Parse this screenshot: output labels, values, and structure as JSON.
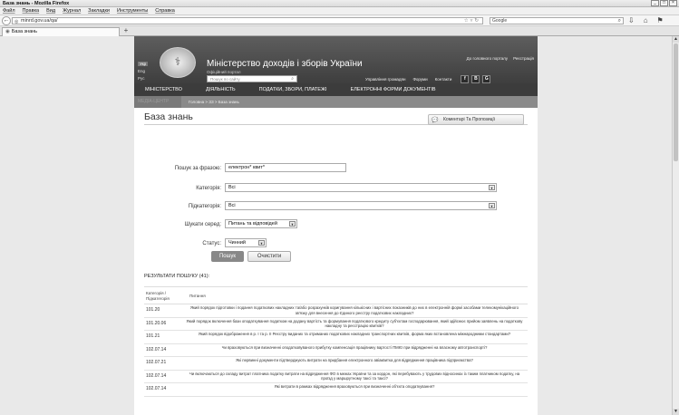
{
  "browser": {
    "window_title": "База знань - Mozilla Firefox",
    "window_controls": [
      "_",
      "□",
      "×"
    ],
    "menu": [
      "Файл",
      "Правка",
      "Вид",
      "Журнал",
      "Закладки",
      "Инструменты",
      "Справка"
    ],
    "url": "minrd.gov.ua/qa/",
    "search_engine": "Google",
    "tab_title": "База знань",
    "new_tab": "+"
  },
  "site": {
    "languages": [
      "Укр",
      "Eng",
      "Рус"
    ],
    "title": "Міністерство доходів і зборів України",
    "subtitle": "Офіційний портал",
    "search_placeholder": "Пошук по сайту",
    "top_links": [
      "До головного порталу",
      "Реєстрація"
    ],
    "sub_links": [
      "Управління громадян",
      "Форуми",
      "Контакти"
    ],
    "social": [
      "f",
      "B",
      "G"
    ],
    "main_nav": [
      "МІНІСТЕРСТВО",
      "ДІЯЛЬНІСТЬ",
      "ПОДАТКИ, ЗБОРИ, ПЛАТЕЖІ",
      "ЕЛЕКТРОННІ ФОРМИ ДОКУМЕНТІВ"
    ],
    "section_label": "МЕДІА-ЦЕНТР",
    "breadcrumb": "Головна > ЗЗ > База знань"
  },
  "page": {
    "heading": "База знань",
    "comments_button": "Коментарі Та Пропозиції",
    "form": {
      "phrase_label": "Пошук за фразою:",
      "phrase_value": "електрон* квит*",
      "category_label": "Категорія:",
      "category_value": "Всі",
      "subcategory_label": "Підкатегорія:",
      "subcategory_value": "Всі",
      "where_label": "Шукати серед:",
      "where_value": "Питань та відповідей",
      "status_label": "Статус:",
      "status_value": "Чинний",
      "search_button": "Пошук",
      "clear_button": "Очистити"
    },
    "results": {
      "title": "РЕЗУЛЬТАТИ ПОШУКУ (41):",
      "col_category": "Категорія / Підкатегорія",
      "col_question": "Питання",
      "rows": [
        {
          "code": "101.20",
          "question": "Який порядок підготовки і подання податкових накладних та/або розрахунків коригування кількісних і вартісних показників до них в електронній формі засобами телекомунікаційного зв'язку для внесення до Єдиного реєстру податкових накладних?"
        },
        {
          "code": "101.20.06",
          "question": "Який порядок включення бази оподаткування податком на додану вартість та формування податкового кредиту суб'єктам господарювання, який здійснює прийом заявлень на податкову накладну та реєстрацію квитків?"
        },
        {
          "code": "101.21",
          "question": "Який порядок відображення в р. І та р. ІІ Реєстру виданих та отриманих податкових накладних транспортних квитків, форма яких встановлена міжнародними стандартами?"
        },
        {
          "code": "102.07.14",
          "question": "Чи враховуються при визначенні оподатковуваного прибутку компенсація працівнику вартості ПМЮ при відрядженні на власному автотранспорті?"
        },
        {
          "code": "102.07.21",
          "question": "Які первинні документи підтверджують витрати на придбання електронного авіаквитка для відрядження працівника підприємства?"
        },
        {
          "code": "102.07.14",
          "question": "Чи включаються до складу витрат платника податку витрати на відрядження ФО в межах України та за кордон, які перебувають у трудових відносинах із таким платником податку, на проїзд у маршрутному таксі та таксі?"
        },
        {
          "code": "102.07.14",
          "question": "Які витрати в рамках відрядження враховуються при визначенні об'єкта оподаткування?"
        }
      ]
    }
  }
}
